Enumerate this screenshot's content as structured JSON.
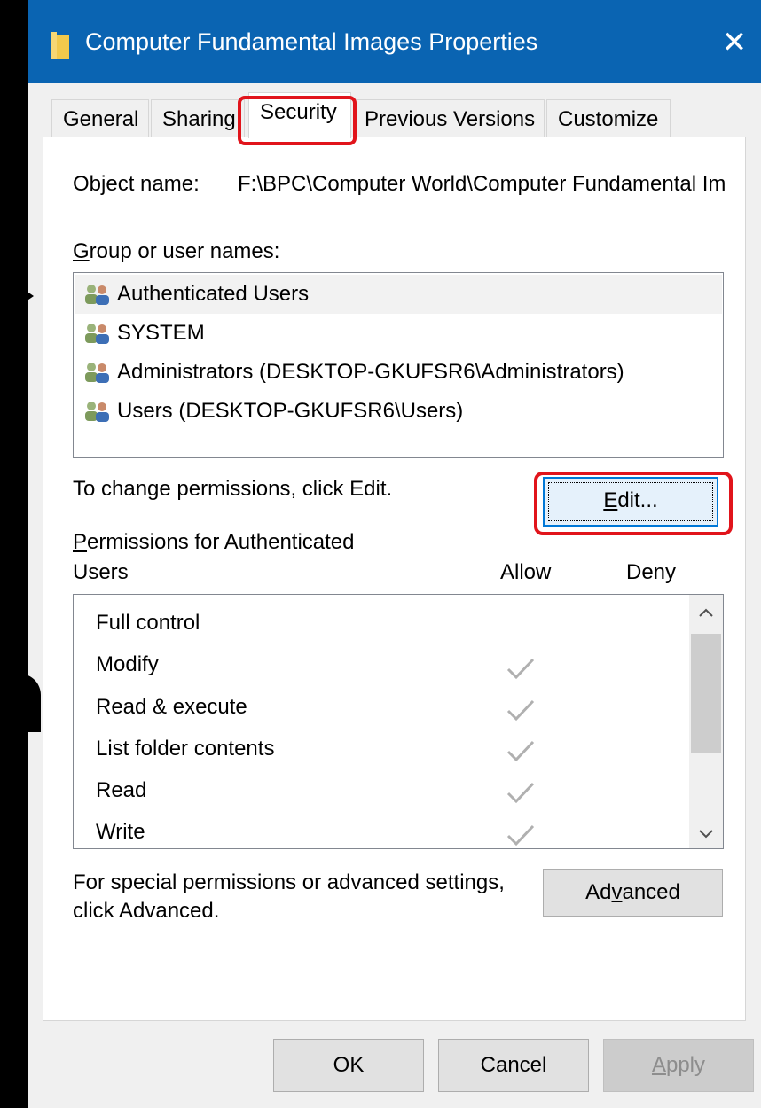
{
  "window": {
    "title": "Computer Fundamental Images Properties",
    "close_glyph": "✕",
    "title_bar_color": "#0a64b2"
  },
  "tabs": [
    {
      "label": "General"
    },
    {
      "label": "Sharing"
    },
    {
      "label": "Security",
      "active": true
    },
    {
      "label": "Previous Versions"
    },
    {
      "label": "Customize"
    }
  ],
  "security": {
    "object_name_label": "Object name:",
    "object_name_value": "F:\\BPC\\Computer World\\Computer Fundamental Im",
    "group_label_first": "G",
    "group_label_rest": "roup or user names:",
    "users": [
      {
        "label": "Authenticated Users",
        "icon": "users-group-icon",
        "selected": true
      },
      {
        "label": "SYSTEM",
        "icon": "users-group-icon"
      },
      {
        "label": "Administrators (DESKTOP-GKUFSR6\\Administrators)",
        "icon": "users-group-icon"
      },
      {
        "label": "Users (DESKTOP-GKUFSR6\\Users)",
        "icon": "users-group-icon"
      }
    ],
    "change_hint": "To change permissions, click Edit.",
    "edit_button_first": "E",
    "edit_button_rest": "dit...",
    "permissions_for_first": "P",
    "permissions_for_rest": "ermissions for Authenticated",
    "permissions_for_line2": "Users",
    "allow_header": "Allow",
    "deny_header": "Deny",
    "permissions": [
      {
        "name": "Full control",
        "allow": false,
        "deny": false
      },
      {
        "name": "Modify",
        "allow": true,
        "deny": false
      },
      {
        "name": "Read & execute",
        "allow": true,
        "deny": false
      },
      {
        "name": "List folder contents",
        "allow": true,
        "deny": false
      },
      {
        "name": "Read",
        "allow": true,
        "deny": false
      },
      {
        "name": "Write",
        "allow": true,
        "deny": false
      }
    ],
    "special_hint_line1": "For special permissions or advanced settings,",
    "special_hint_line2": "click Advanced.",
    "advanced_button_pre": "Ad",
    "advanced_button_u": "v",
    "advanced_button_post": "anced"
  },
  "footer": {
    "ok_label": "OK",
    "cancel_label": "Cancel",
    "apply_first": "A",
    "apply_rest": "pply"
  },
  "highlight_color": "#e1141b"
}
